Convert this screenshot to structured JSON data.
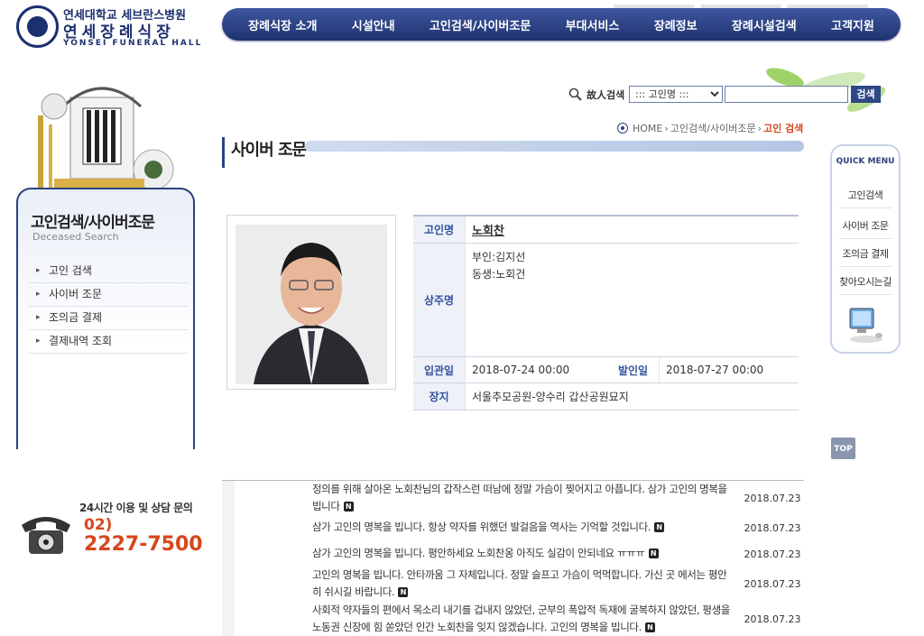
{
  "header": {
    "logo_line1": "연세대학교 세브란스병원",
    "logo_line2": "연세장례식장",
    "logo_line3": "YONSEI FUNERAL HALL",
    "nav": [
      "장례식장 소개",
      "시설안내",
      "고인검색/사이버조문",
      "부대서비스",
      "장례정보",
      "장례시설검색",
      "고객지원"
    ]
  },
  "search": {
    "label": "故人검색",
    "select_value": "::: 고인명 :::",
    "input_value": "",
    "button_label": "검색"
  },
  "breadcrumb": {
    "home": "HOME",
    "section": "고인검색/사이버조문",
    "current": "고인 검색"
  },
  "sidebar": {
    "title": "고인검색/사이버조문",
    "subtitle": "Deceased Search",
    "items": [
      {
        "label": "고인 검색"
      },
      {
        "label": "사이버 조문"
      },
      {
        "label": "조의금 결제"
      },
      {
        "label": "결제내역 조회"
      }
    ]
  },
  "contact": {
    "caption": "24시간 이용 및 상담 문의",
    "area_code": "02)",
    "number": "2227-7500"
  },
  "page": {
    "title": "사이버 조문"
  },
  "deceased": {
    "name_label": "고인명",
    "name": "노회찬",
    "mourners_label": "상주명",
    "mourners": [
      "부인:김지선",
      "동생:노회건"
    ],
    "admission_label": "입관일",
    "admission_date": "2018-07-24 00:00",
    "departure_label": "발인일",
    "departure_date": "2018-07-27 00:00",
    "burial_label": "장지",
    "burial_place": "서울추모공원-양수리 갑산공원묘지"
  },
  "quick_menu": {
    "title": "QUICK MENU",
    "items": [
      "고인검색",
      "사이버 조문",
      "조의금 결제",
      "찾아오시는길"
    ]
  },
  "top_button": "TOP",
  "messages": [
    {
      "text": "정의를 위해 살아온 노회찬님의 갑작스런 떠남에 정말 가슴이 찢어지고 아픕니다. 삼가 고인의 명복을 빕니다",
      "date": "2018.07.23",
      "badge": "N"
    },
    {
      "text": "삼가 고인의 명복을 빕니다. 항상 약자를 위했던 발걸음을 역사는 기억할 것입니다.",
      "date": "2018.07.23",
      "badge": "N"
    },
    {
      "text": "삼가 고인의 명복을 빕니다. 평안하세요 노회찬옹 아직도 실감이 안되네요 ㅠㅠㅠ",
      "date": "2018.07.23",
      "badge": "N"
    },
    {
      "text": "고인의 명복을 빕니다. 안타까움 그 자체입니다. 정말 슬프고 가슴이 먹먹합니다. 가신 곳 에서는 평안히 쉬시길 바랍니다.",
      "date": "2018.07.23",
      "badge": "N"
    },
    {
      "text": "사회적 약자들의 편에서 목소리 내기를 겁내지 않았던, 군부의 폭압적 독재에 굴복하지 않았던, 평생을 노동권 신장에 힘 쏟았던 인간 노회찬을 잊지 않겠습니다. 고인의 명복을 빕니다.",
      "date": "2018.07.23",
      "badge": "N"
    }
  ]
}
